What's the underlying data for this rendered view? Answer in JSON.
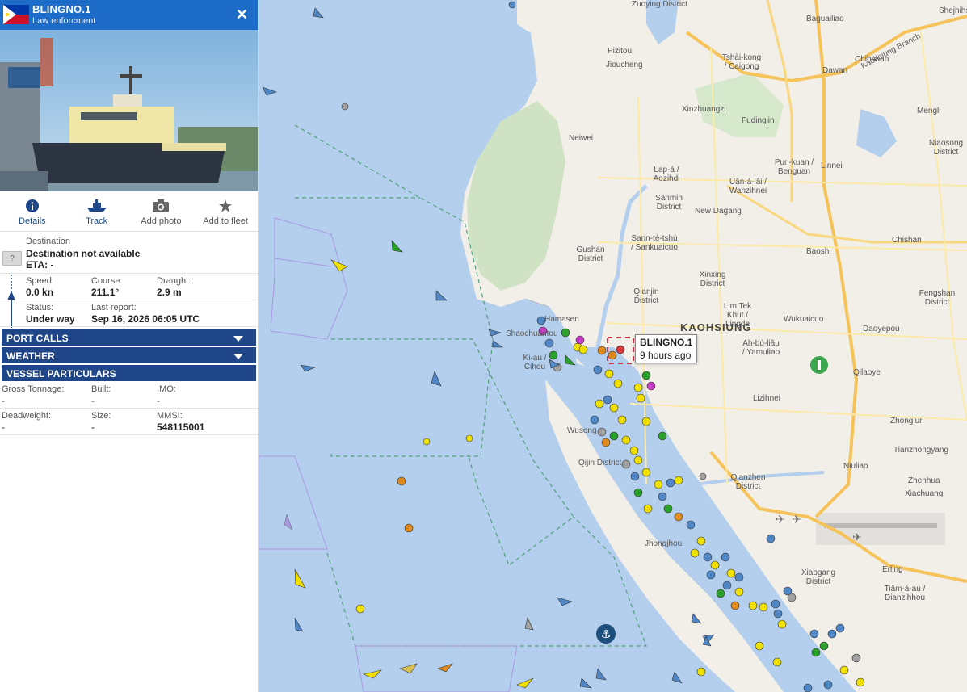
{
  "vessel": {
    "name": "BLINGNO.1",
    "type": "Law enforcment",
    "flag_colors": {
      "blue": "#0038a8",
      "red": "#ce1126",
      "white": "#ffffff",
      "sun": "#fcd116"
    }
  },
  "tabs": [
    {
      "label": "Details",
      "icon": "info-icon"
    },
    {
      "label": "Track",
      "icon": "ship-track-icon"
    },
    {
      "label": "Add photo",
      "icon": "camera-icon"
    },
    {
      "label": "Add to fleet",
      "icon": "star-icon"
    }
  ],
  "destination": {
    "label": "Destination",
    "value": "Destination not available",
    "eta": "ETA: -",
    "badge": "?"
  },
  "stats": {
    "speed_label": "Speed:",
    "speed": "0.0 kn",
    "course_label": "Course:",
    "course": "211.1°",
    "draught_label": "Draught:",
    "draught": "2.9 m",
    "status_label": "Status:",
    "status": "Under way",
    "report_label": "Last report:",
    "report": "Sep 16, 2026 06:05 UTC"
  },
  "sections": {
    "port_calls": "PORT CALLS",
    "weather": "WEATHER",
    "particulars": "VESSEL PARTICULARS"
  },
  "particulars": {
    "gt_label": "Gross Tonnage:",
    "gt": "-",
    "built_label": "Built:",
    "built": "-",
    "imo_label": "IMO:",
    "imo": "-",
    "dwt_label": "Deadweight:",
    "dwt": "-",
    "size_label": "Size:",
    "size": "-",
    "mmsi_label": "MMSI:",
    "mmsi": "548115001"
  },
  "tooltip": {
    "name": "BLINGNO.1",
    "time": "9 hours ago"
  },
  "map": {
    "city": "KAOHSIUNG",
    "districts": [
      "Zuoying District",
      "Pizitou",
      "Jioucheng",
      "Tshài-kong / Caigong",
      "Baguailiao",
      "Dawan",
      "Kaohsiung Branch",
      "Chihshan",
      "Shejhihsi",
      "Neiwei",
      "Xinzhuangzi",
      "Fudingjin",
      "Mengli",
      "Niaosong District",
      "Lap-á / Aozihdi",
      "Sanmin District",
      "Uân-á-lâi / Wanzihnei",
      "New Dagang",
      "Pun-kuan / Benguan",
      "Linnei",
      "Gushan District",
      "Sann-tè-tshù / Sankuaicuo",
      "Qianjin District",
      "Xinxing District",
      "Baoshi",
      "Chishan",
      "Fengshan District",
      "Lim Tek Khut / Lingde",
      "Wukuaicuo",
      "Daoyepou",
      "Ah-bú-liâu / Yamuliao",
      "Qilaoye",
      "Lizihnei",
      "Zhonglun",
      "Tianzhongyang",
      "Niuliao",
      "Zhenhua",
      "Qianzhen District",
      "Xiachuang",
      "Xiaogang District",
      "Erling",
      "Tiâm-á-au / Dianzihhou",
      "Qijin District",
      "Jhongjhou",
      "Ki-au / Cihou",
      "Shaochuantou",
      "Hamasen",
      "Wusong"
    ],
    "marker_colors": {
      "yellow": "#f0e000",
      "orange": "#e08a1e",
      "blue": "#4f86c6",
      "green": "#2aa12a",
      "gray": "#a0a0a0",
      "magenta": "#c83cc8",
      "red": "#d63a3a"
    }
  }
}
